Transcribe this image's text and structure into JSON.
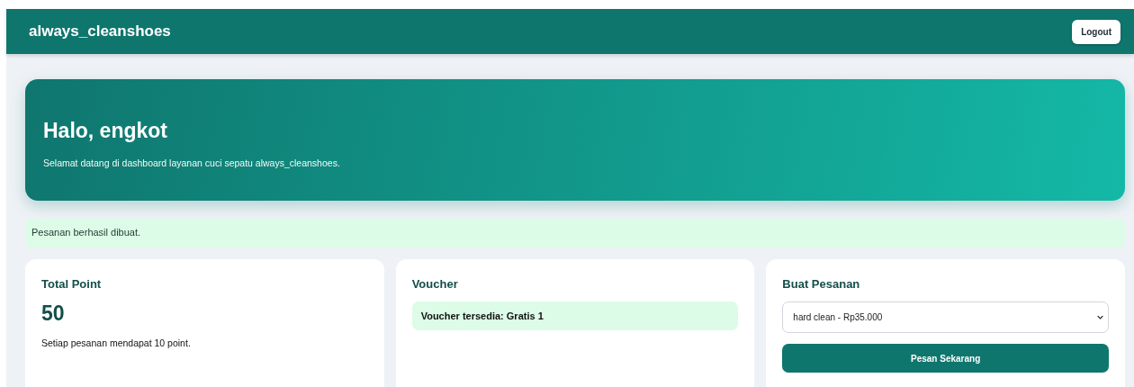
{
  "header": {
    "brand": "always_cleanshoes",
    "logout_button": "Logout"
  },
  "hero": {
    "title": "Halo, engkot",
    "subtitle": "Selamat datang di dashboard layanan cuci sepatu always_cleanshoes."
  },
  "alert": {
    "kind": "success",
    "text": "Pesanan berhasil dibuat."
  },
  "cards": [
    {
      "kind": "points",
      "title": "Total Point",
      "value": "50",
      "note": "Setiap pesanan mendapat 10 point."
    },
    {
      "kind": "voucher",
      "title": "Voucher",
      "badge": "Voucher tersedia: Gratis 1"
    },
    {
      "kind": "order",
      "title": "Buat Pesanan",
      "select_value": "hard clean - Rp35.000",
      "button": "Pesan Sekarang"
    }
  ]
}
